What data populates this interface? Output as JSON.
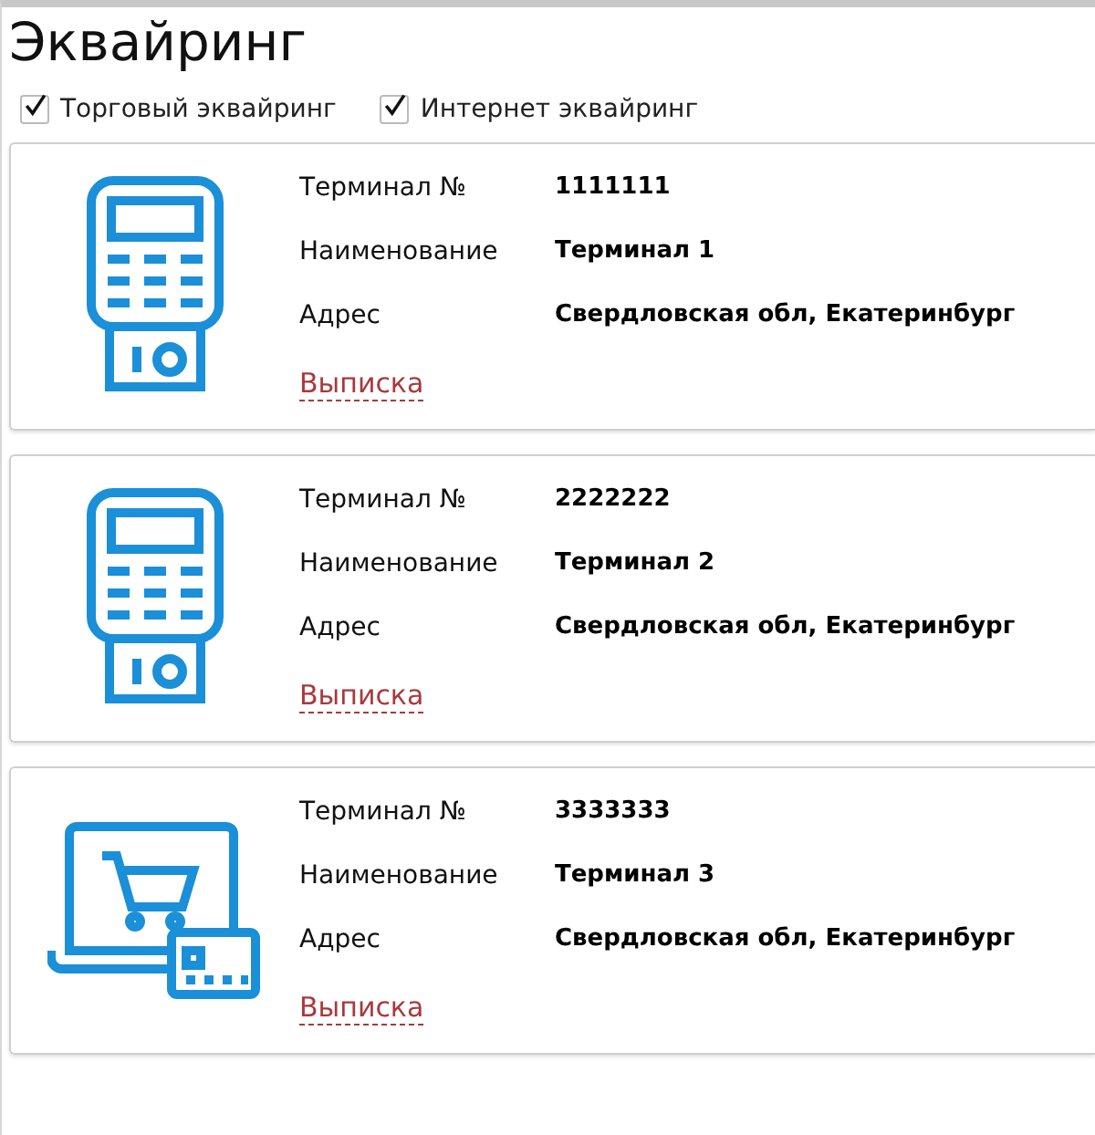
{
  "title": "Эквайринг",
  "filters": [
    {
      "label": "Торговый эквайринг",
      "checked": true
    },
    {
      "label": "Интернет эквайринг",
      "checked": true
    }
  ],
  "terminals": [
    {
      "kind": "terminal",
      "fields": [
        {
          "label": "Терминал №",
          "value": "1111111"
        },
        {
          "label": "Наименование",
          "value": "Терминал 1"
        },
        {
          "label": "Адрес",
          "value": "Свердловская обл, Екатеринбург"
        }
      ],
      "link": "Выписка"
    },
    {
      "kind": "terminal",
      "fields": [
        {
          "label": "Терминал №",
          "value": "2222222"
        },
        {
          "label": "Наименование",
          "value": "Терминал 2"
        },
        {
          "label": "Адрес",
          "value": "Свердловская обл, Екатеринбург"
        }
      ],
      "link": "Выписка"
    },
    {
      "kind": "online",
      "fields": [
        {
          "label": "Терминал №",
          "value": "3333333"
        },
        {
          "label": "Наименование",
          "value": "Терминал 3"
        },
        {
          "label": "Адрес",
          "value": "Свердловская обл, Екатеринбург"
        }
      ],
      "link": "Выписка"
    }
  ]
}
